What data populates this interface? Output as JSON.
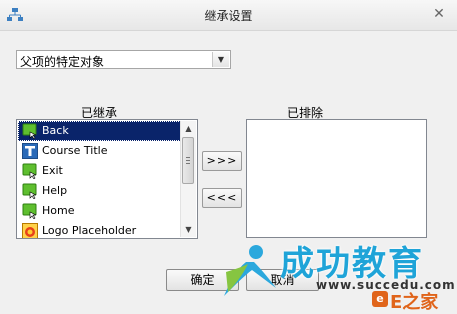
{
  "window": {
    "title": "继承设置",
    "close_glyph": "✕",
    "accent": "#0a246a"
  },
  "dropdown": {
    "selected": "父项的特定对象",
    "arrow_glyph": "▼"
  },
  "inherited": {
    "label": "已继承",
    "items": [
      {
        "label": "Back",
        "icon": "green-button-icon",
        "selected": true
      },
      {
        "label": "Course Title",
        "icon": "text-t-icon",
        "selected": false
      },
      {
        "label": "Exit",
        "icon": "green-button-icon",
        "selected": false
      },
      {
        "label": "Help",
        "icon": "green-button-icon",
        "selected": false
      },
      {
        "label": "Home",
        "icon": "green-button-icon",
        "selected": false
      },
      {
        "label": "Logo Placeholder",
        "icon": "image-placeholder-icon",
        "selected": false
      }
    ],
    "scroll": {
      "up_glyph": "▲",
      "down_glyph": "▼"
    }
  },
  "excluded": {
    "label": "已排除",
    "items": []
  },
  "buttons": {
    "move_right": ">>>",
    "move_left": "<<<",
    "ok": "确定",
    "cancel": "取消"
  },
  "watermark": {
    "main": "成功教育",
    "url": "www.succedu.com",
    "site": "E之家",
    "cam_letter": "e",
    "colors": {
      "main": "#1fa4d8",
      "site": "#e0641a"
    }
  }
}
